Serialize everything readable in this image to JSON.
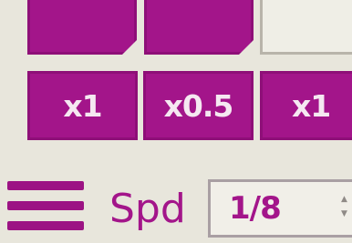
{
  "speed_buttons": [
    {
      "label": "x1"
    },
    {
      "label": "x0.5"
    },
    {
      "label": "x1"
    }
  ],
  "speed_control": {
    "label": "Spd",
    "value": "1/8",
    "spin_up_icon": "triangle-up",
    "spin_down_icon": "triangle-down"
  },
  "menu": {
    "icon": "hamburger-menu"
  },
  "colors": {
    "accent": "#a3158a",
    "background": "#e8e6dc",
    "text_on_accent": "#f5e8f1"
  }
}
